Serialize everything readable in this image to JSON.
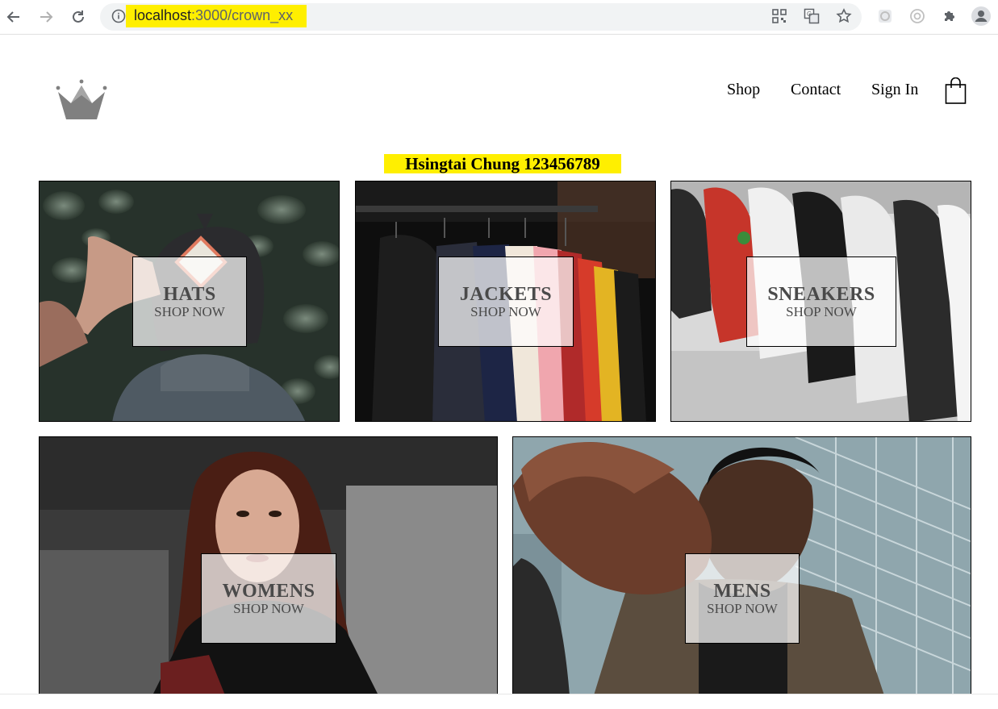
{
  "browser": {
    "url_host": "localhost",
    "url_port": ":3000",
    "url_path": "/crown_xx"
  },
  "nav": {
    "shop": "Shop",
    "contact": "Contact",
    "sign_in": "Sign In"
  },
  "banner": "Hsingtai Chung 123456789",
  "menu": {
    "hats": {
      "title": "HATS",
      "subtitle": "SHOP NOW"
    },
    "jackets": {
      "title": "JACKETS",
      "subtitle": "SHOP NOW"
    },
    "sneakers": {
      "title": "SNEAKERS",
      "subtitle": "SHOP NOW"
    },
    "womens": {
      "title": "WOMENS",
      "subtitle": "SHOP NOW"
    },
    "mens": {
      "title": "MENS",
      "subtitle": "SHOP NOW"
    }
  },
  "colors": {
    "highlight": "#ffef00",
    "overlay": "rgba(255,255,255,0.72)",
    "crown": "#808080"
  }
}
